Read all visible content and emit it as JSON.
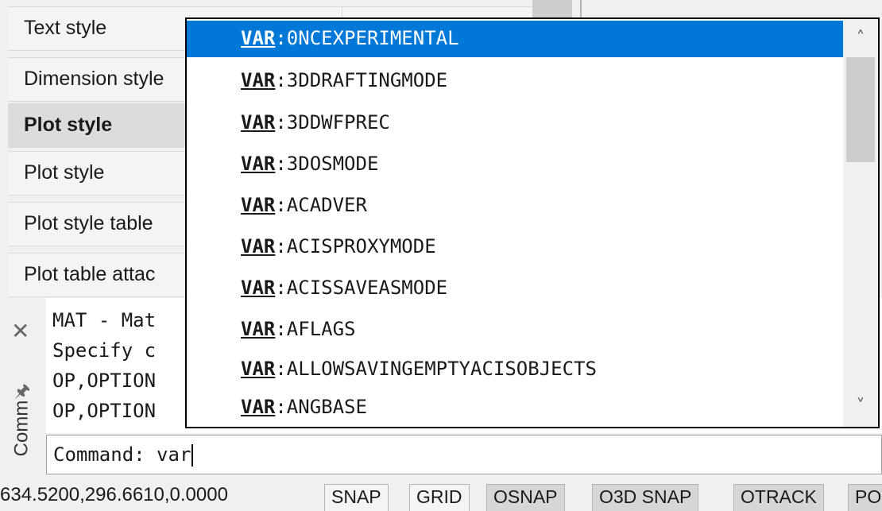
{
  "properties": {
    "rows": [
      {
        "name": "Text style",
        "bold": false
      },
      {
        "name": "Dimension style",
        "bold": false
      },
      {
        "name": "Plot style",
        "bold": true
      },
      {
        "name": "Plot style",
        "bold": false
      },
      {
        "name": "Plot style table",
        "bold": false
      },
      {
        "name": "Plot table attac",
        "bold": false
      }
    ]
  },
  "command_window": {
    "label": "Comm",
    "close_icon": "close-icon",
    "pin_icon": "pin-icon",
    "history": [
      "MAT - Mat",
      "Specify c",
      "OP,OPTION",
      "OP,OPTION"
    ],
    "input_prompt": "Command: ",
    "input_value": "var"
  },
  "autocomplete": {
    "prefix": "VAR",
    "items": [
      {
        "prefix": "VAR",
        "name": ":0NCEXPERIMENTAL",
        "selected": true
      },
      {
        "prefix": "VAR",
        "name": ":3DDRAFTINGMODE",
        "selected": false
      },
      {
        "prefix": "VAR",
        "name": ":3DDWFPREC",
        "selected": false
      },
      {
        "prefix": "VAR",
        "name": ":3DOSMODE",
        "selected": false
      },
      {
        "prefix": "VAR",
        "name": ":ACADVER",
        "selected": false
      },
      {
        "prefix": "VAR",
        "name": ":ACISPROXYMODE",
        "selected": false
      },
      {
        "prefix": "VAR",
        "name": ":ACISSAVEASMODE",
        "selected": false
      },
      {
        "prefix": "VAR",
        "name": ":AFLAGS",
        "selected": false
      },
      {
        "prefix": "VAR",
        "name": ":ALLOWSAVINGEMPTYACISOBJECTS",
        "selected": false
      },
      {
        "prefix": "VAR",
        "name": ":ANGBASE",
        "selected": false
      }
    ],
    "scroll_up_icon": "chevron-up-icon",
    "scroll_down_icon": "chevron-down-icon"
  },
  "status_bar": {
    "coordinates": "634.5200,296.6610,0.0000",
    "toggles": [
      {
        "label": "SNAP",
        "on": false
      },
      {
        "label": "GRID",
        "on": false
      },
      {
        "label": "OSNAP",
        "on": true
      },
      {
        "label": "O3D SNAP",
        "on": true
      },
      {
        "label": "OTRACK",
        "on": true
      },
      {
        "label": "PO",
        "on": true
      }
    ]
  },
  "colors": {
    "selection": "#0078d7",
    "panel_bg": "#f0f0f0",
    "highlight_row": "#dcdcdc"
  }
}
